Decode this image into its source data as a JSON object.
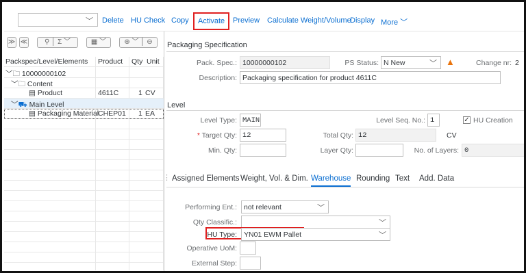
{
  "toolbar": {
    "buttons": [
      "Delete",
      "HU Check",
      "Copy",
      "Activate",
      "Preview",
      "Calculate Weight/Volume",
      "Display",
      "More"
    ]
  },
  "tree": {
    "headers": {
      "elements": "Packspec/Level/Elements",
      "product": "Product",
      "qty": "Qty",
      "unit": "Unit"
    },
    "rows": [
      {
        "label": "10000000102",
        "product": "",
        "qty": "",
        "unit": ""
      },
      {
        "label": "Content",
        "product": "",
        "qty": "",
        "unit": ""
      },
      {
        "label": "Product",
        "product": "4611C",
        "qty": "1",
        "unit": "CV"
      },
      {
        "label": "Main Level",
        "product": "",
        "qty": "",
        "unit": ""
      },
      {
        "label": "Packaging Material",
        "product": "CHEP01",
        "qty": "1",
        "unit": "EA"
      }
    ]
  },
  "packspec": {
    "title": "Packaging Specification",
    "pack_spec_label": "Pack. Spec.:",
    "pack_spec_value": "10000000102",
    "ps_status_label": "PS Status:",
    "ps_status_value": "N New",
    "change_nr_label": "Change nr:",
    "change_nr_value": "2",
    "description_label": "Description:",
    "description_value": "Packaging specification for product 4611C"
  },
  "level": {
    "title": "Level",
    "level_type_label": "Level Type:",
    "level_type_value": "MAIN",
    "level_seq_label": "Level Seq. No.:",
    "level_seq_value": "1",
    "hu_creation_label": "HU Creation",
    "hu_creation_checked": true,
    "target_qty_label": "Target Qty:",
    "target_qty_value": "12",
    "total_qty_label": "Total Qty:",
    "total_qty_value": "12",
    "total_qty_unit": "CV",
    "min_qty_label": "Min. Qty:",
    "min_qty_value": "",
    "layer_qty_label": "Layer Qty:",
    "layer_qty_value": "",
    "no_layers_label": "No. of Layers:",
    "no_layers_value": "0"
  },
  "tabs": [
    "Assigned Elements",
    "Weight, Vol. & Dim.",
    "Warehouse",
    "Rounding",
    "Text",
    "Add. Data"
  ],
  "active_tab": "Warehouse",
  "warehouse": {
    "performing_ent_label": "Performing Ent.:",
    "performing_ent_value": "not relevant",
    "qty_classific_label": "Qty Classific.:",
    "qty_classific_value": "",
    "hu_type_label": "HU Type:",
    "hu_type_value": "YN01 EWM Pallet",
    "operative_uom_label": "Operative UoM:",
    "operative_uom_value": "",
    "external_step_label": "External Step:",
    "external_step_value": ""
  },
  "colors": {
    "accent": "#0a6ed1",
    "highlight": "#e02020",
    "warning": "#e9730c"
  }
}
